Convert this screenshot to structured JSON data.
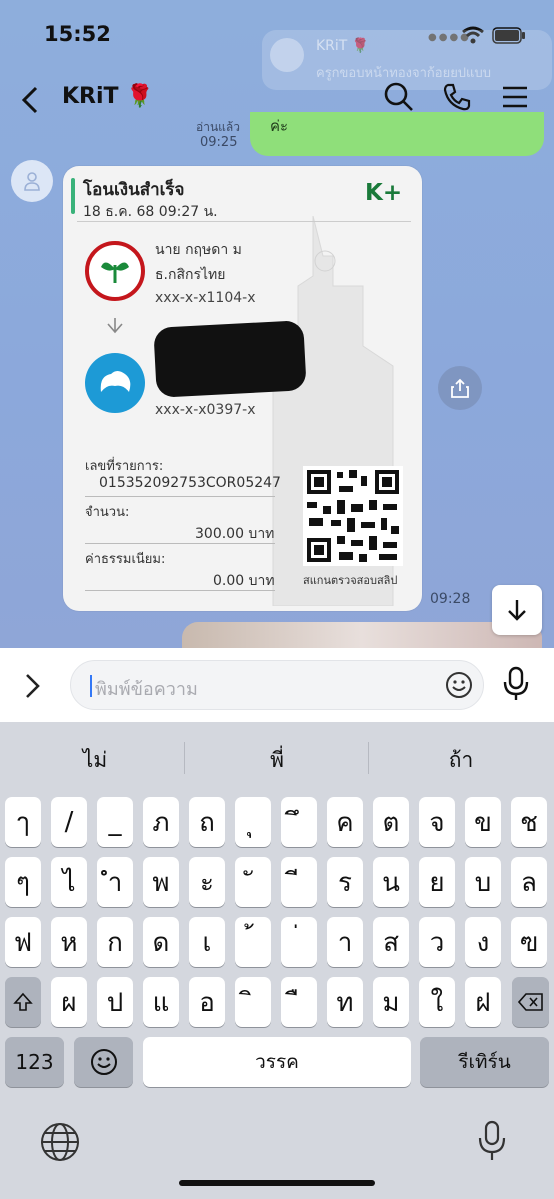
{
  "status": {
    "time": "15:52"
  },
  "notification": {
    "name": "KRiT 🌹",
    "message": "ครูกขอบหน้าทองจาก้อยยปแบบ"
  },
  "header": {
    "title": "KRiT 🌹",
    "back_label": "<"
  },
  "previous_message": {
    "time_label": "อ่านแล้ว",
    "time": "09:25",
    "text": "ค่ะ"
  },
  "slip": {
    "title": "โอนเงินสำเร็จ",
    "date": "18 ธ.ค. 68  09:27 น.",
    "brand": "K+",
    "sender_name": "นาย กฤษดา ม",
    "sender_bank": "ธ.กสิกรไทย",
    "sender_account": "xxx-x-x1104-x",
    "receiver_account": "xxx-x-x0397-x",
    "ref_label": "เลขที่รายการ:",
    "ref_value": "015352092753COR05247",
    "amount_label": "จำนวน:",
    "amount_value": "300.00 บาท",
    "fee_label": "ค่าธรรมเนียม:",
    "fee_value": "0.00 บาท",
    "qr_label": "สแกนตรวจสอบสลิป",
    "time": "09:28"
  },
  "input": {
    "placeholder": "พิมพ์ข้อความ"
  },
  "keyboard": {
    "suggestions": [
      "ไม่",
      "พี่",
      "ถ้า"
    ],
    "row1": [
      "ๅ",
      "/",
      "_",
      "ภ",
      "ถ",
      "ุ",
      "ึ",
      "ค",
      "ต",
      "จ",
      "ข",
      "ช"
    ],
    "row2": [
      "ๆ",
      "ไ",
      "ำ",
      "พ",
      "ะ",
      "ั",
      "ี",
      "ร",
      "น",
      "ย",
      "บ",
      "ล"
    ],
    "row3": [
      "ฟ",
      "ห",
      "ก",
      "ด",
      "เ",
      "้",
      "่",
      "า",
      "ส",
      "ว",
      "ง",
      "ฃ"
    ],
    "row4": [
      "ผ",
      "ป",
      "แ",
      "อ",
      "ิ",
      "ื",
      "ท",
      "ม",
      "ใ",
      "ฝ"
    ],
    "numbers_label": "123",
    "space_label": "วรรค",
    "return_label": "รีเทิร์น"
  },
  "colors": {
    "bubble_green": "#8fdf7a",
    "chat_bg": "#8eaedc",
    "kplus_green": "#1a7a3a"
  }
}
